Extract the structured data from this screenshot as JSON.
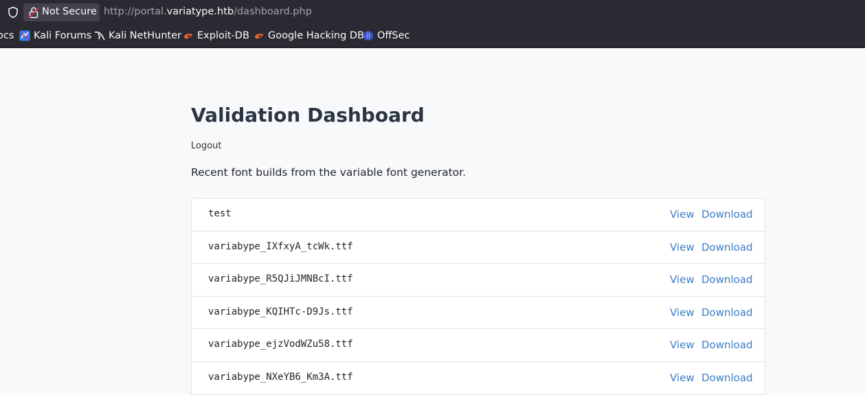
{
  "browser": {
    "security_label": "Not Secure",
    "url_prefix": "http://portal.",
    "url_host": "variatype.htb",
    "url_path": "/dashboard.php",
    "bookmarks": [
      {
        "label": "ocs",
        "icon": "docs-icon"
      },
      {
        "label": "Kali Forums",
        "icon": "kali-forums-icon"
      },
      {
        "label": "Kali NetHunter",
        "icon": "kali-nethunter-icon"
      },
      {
        "label": "Exploit-DB",
        "icon": "exploit-db-icon"
      },
      {
        "label": "Google Hacking DB",
        "icon": "google-hacking-db-icon"
      },
      {
        "label": "OffSec",
        "icon": "offsec-icon"
      }
    ]
  },
  "page": {
    "title": "Validation Dashboard",
    "logout_label": "Logout",
    "intro": "Recent font builds from the variable font generator.",
    "builds": [
      {
        "name": "test",
        "view": "View",
        "download": "Download"
      },
      {
        "name": "variabype_IXfxyA_tcWk.ttf",
        "view": "View",
        "download": "Download"
      },
      {
        "name": "variabype_R5QJiJMNBcI.ttf",
        "view": "View",
        "download": "Download"
      },
      {
        "name": "variabype_KQIHTc-D9Js.ttf",
        "view": "View",
        "download": "Download"
      },
      {
        "name": "variabype_ejzVodWZu58.ttf",
        "view": "View",
        "download": "Download"
      },
      {
        "name": "variabype_NXeYB6_Km3A.ttf",
        "view": "View",
        "download": "Download"
      }
    ]
  },
  "colors": {
    "chrome_bg": "#2b2a33",
    "link": "#3b7dc4",
    "title": "#2a3442"
  }
}
